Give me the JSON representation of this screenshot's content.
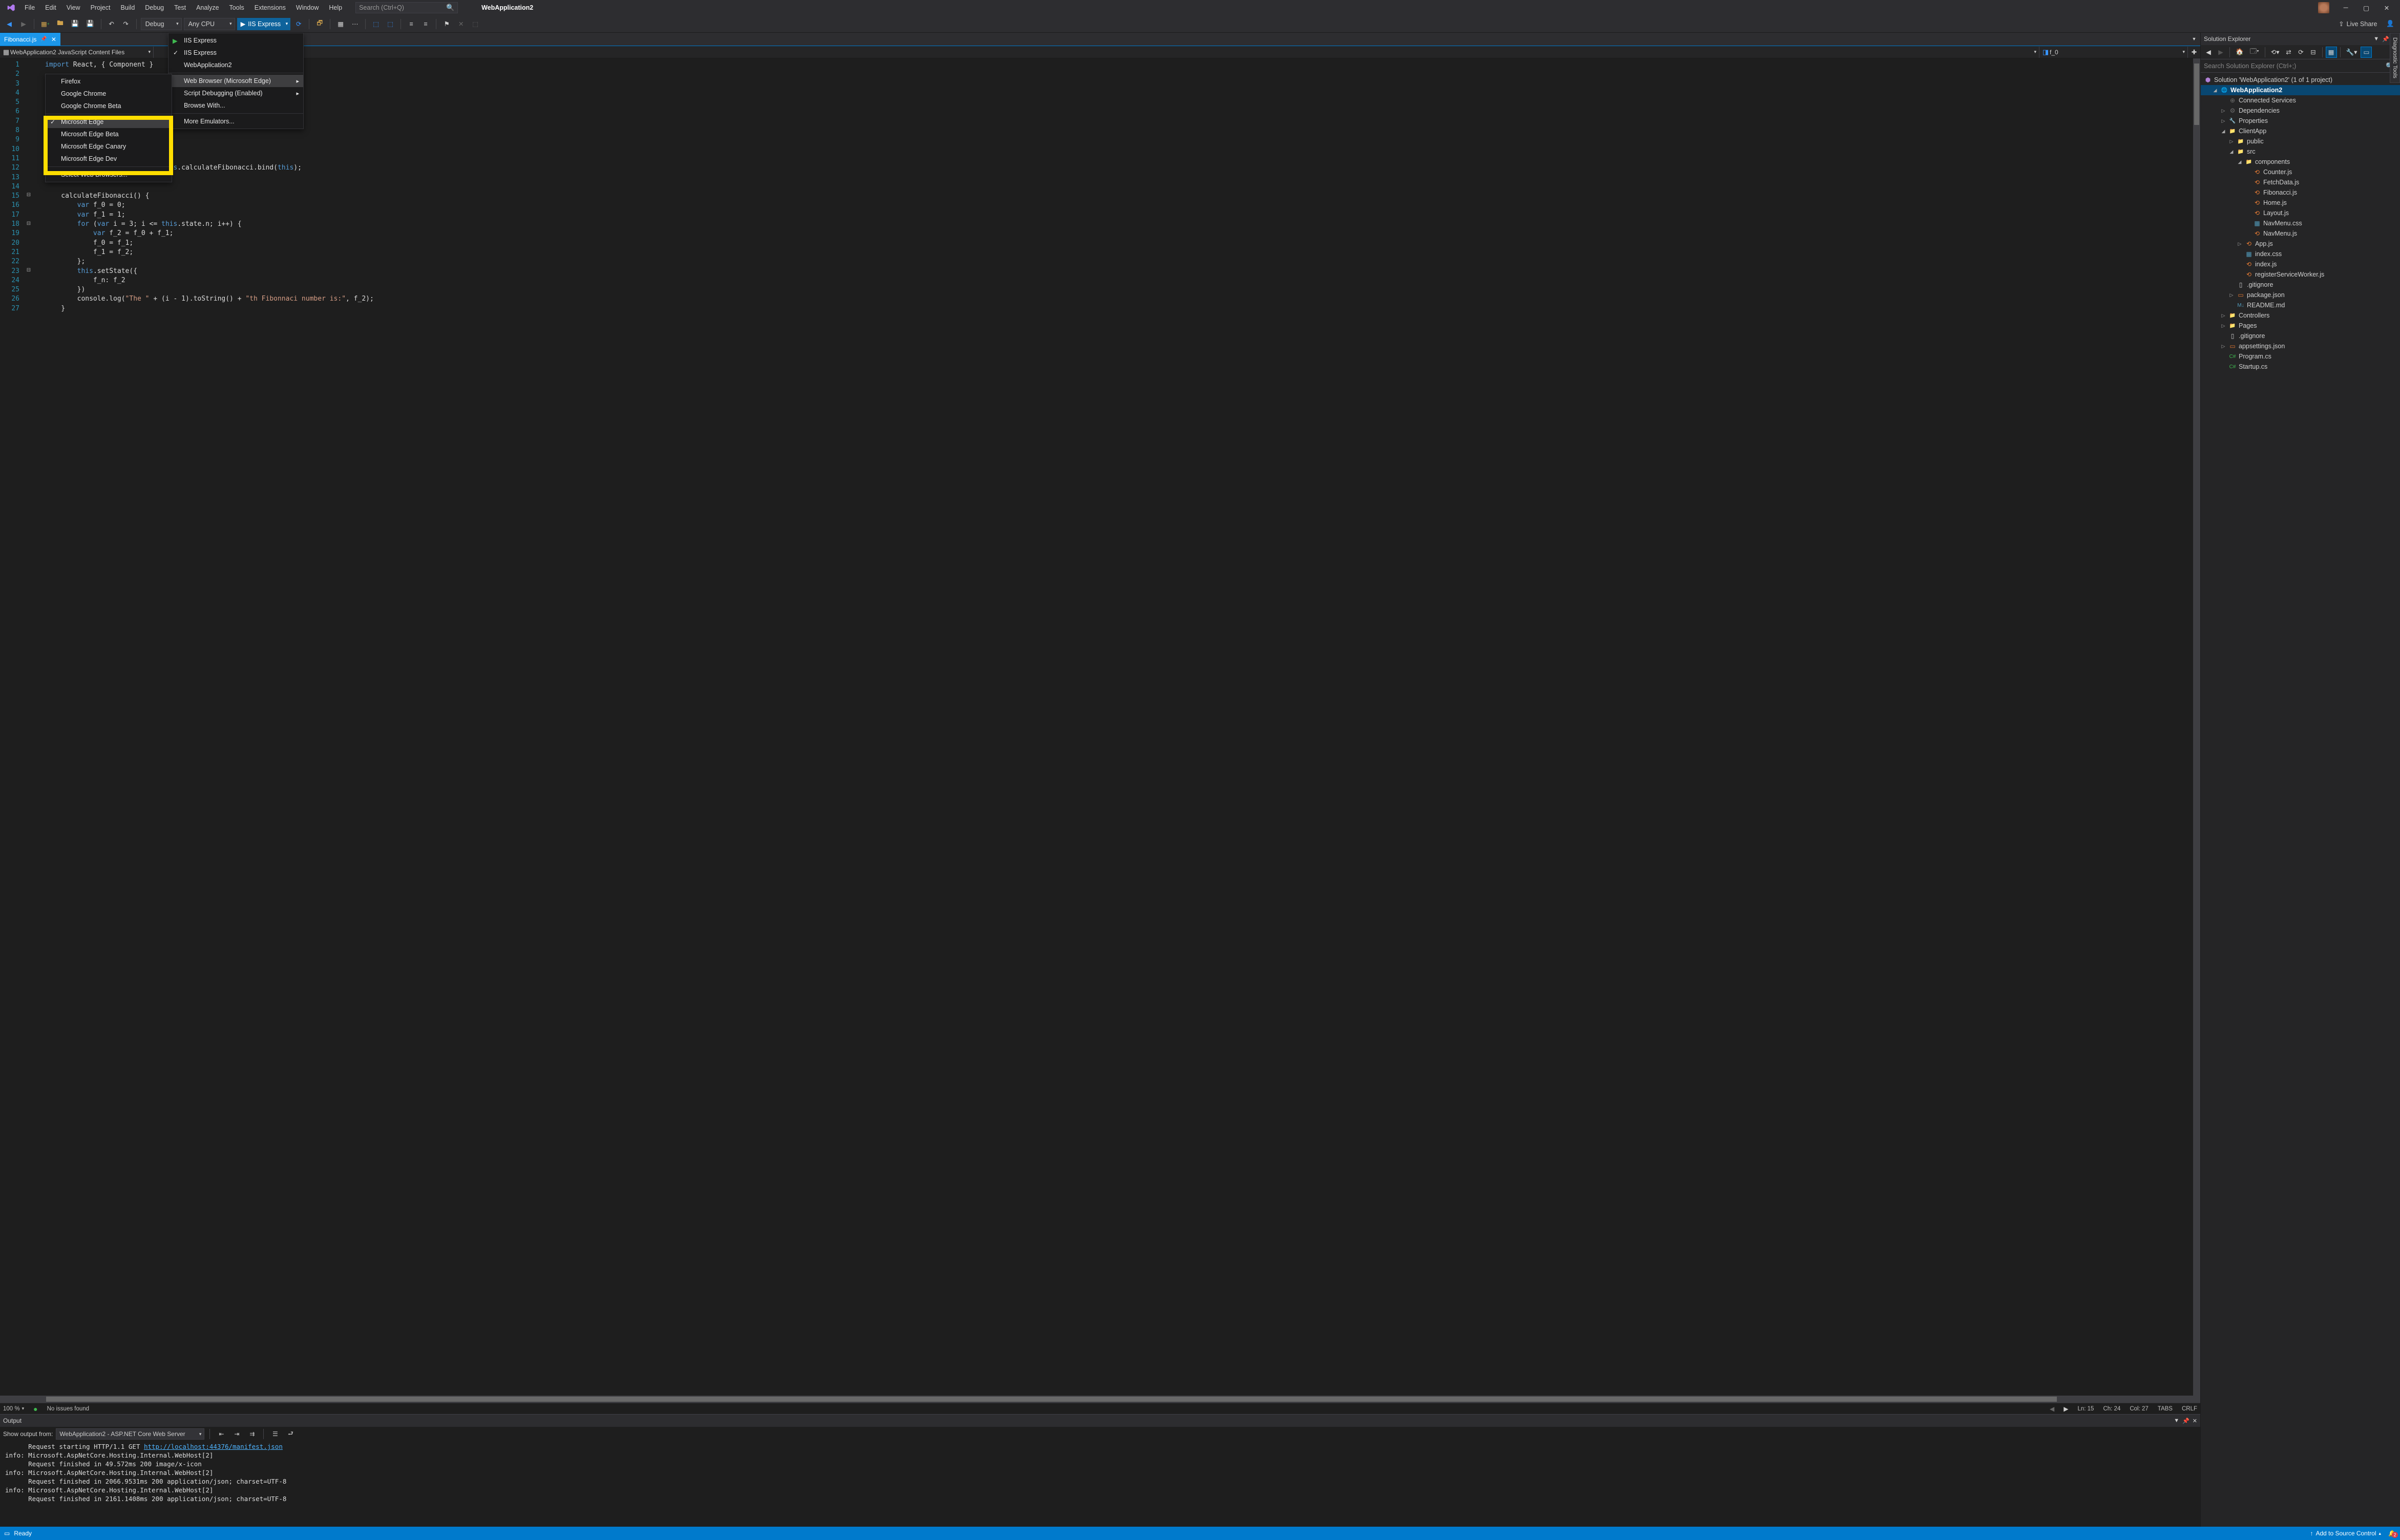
{
  "title_app": "WebApplication2",
  "menu": [
    "File",
    "Edit",
    "View",
    "Project",
    "Build",
    "Debug",
    "Test",
    "Analyze",
    "Tools",
    "Extensions",
    "Window",
    "Help"
  ],
  "search_placeholder": "Search (Ctrl+Q)",
  "toolbar": {
    "config": "Debug",
    "platform": "Any CPU",
    "run": "IIS Express",
    "liveshare": "Live Share"
  },
  "debug_menu": {
    "items": [
      {
        "label": "IIS Express",
        "icon": "play",
        "chk": false
      },
      {
        "label": "IIS Express",
        "chk": true
      },
      {
        "label": "WebApplication2"
      }
    ],
    "sep1": true,
    "items2": [
      {
        "label": "Web Browser (Microsoft Edge)",
        "sub": true,
        "hov": true
      },
      {
        "label": "Script Debugging (Enabled)",
        "sub": true
      },
      {
        "label": "Browse With..."
      }
    ],
    "sep2": true,
    "items3": [
      {
        "label": "More Emulators..."
      }
    ]
  },
  "browser_menu": {
    "top": [
      {
        "label": "Firefox"
      },
      {
        "label": "Google Chrome"
      },
      {
        "label": "Google Chrome Beta"
      }
    ],
    "boxed": [
      {
        "label": "Microsoft Edge",
        "chk": true,
        "hov": true
      },
      {
        "label": "Microsoft Edge Beta"
      },
      {
        "label": "Microsoft Edge Canary"
      },
      {
        "label": "Microsoft Edge Dev"
      }
    ],
    "bottom": [
      {
        "label": "Select Web Browsers..."
      }
    ]
  },
  "editor": {
    "tab": "Fibonacci.js",
    "nav_scope": "WebApplication2 JavaScript Content Files",
    "nav_member": "f_0",
    "no_issues": "No issues found",
    "zoom": "100 %",
    "ln": "Ln: 15",
    "ch": "Ch: 24",
    "col": "Col: 27",
    "tabs": "TABS",
    "crlf": "CRLF"
  },
  "code_lines": [
    {
      "n": 1,
      "html": "<span class='kw'>import</span> React, { Component }"
    },
    {
      "n": 2,
      "html": ""
    },
    {
      "n": 3,
      "html": ""
    },
    {
      "n": 4,
      "html": ""
    },
    {
      "n": 5,
      "html": ""
    },
    {
      "n": 6,
      "html": ""
    },
    {
      "n": 7,
      "html": ""
    },
    {
      "n": 8,
      "html": ""
    },
    {
      "n": 9,
      "html": ""
    },
    {
      "n": 10,
      "html": ""
    },
    {
      "n": 11,
      "html": ""
    },
    {
      "n": 12,
      "html": "                         <span style='color:#dcdcdc'>i</span> = <span class='kw'>this</span>.calculateFibonacci.bind(<span class='kw'>this</span>);"
    },
    {
      "n": 13,
      "html": ""
    },
    {
      "n": 14,
      "html": ""
    },
    {
      "n": 15,
      "html": "    calculateFibonacci() {"
    },
    {
      "n": 16,
      "html": "        <span class='kw'>var</span> f_0 = 0;"
    },
    {
      "n": 17,
      "html": "        <span class='kw'>var</span> f_1 = 1;"
    },
    {
      "n": 18,
      "html": "        <span class='kw'>for</span> (<span class='kw'>var</span> i = 3; i &lt;= <span class='kw'>this</span>.state.n; i++) {"
    },
    {
      "n": 19,
      "html": "            <span class='kw'>var</span> f_2 = f_0 + f_1;"
    },
    {
      "n": 20,
      "html": "            f_0 = f_1;"
    },
    {
      "n": 21,
      "html": "            f_1 = f_2;"
    },
    {
      "n": 22,
      "html": "        };"
    },
    {
      "n": 23,
      "html": "        <span class='kw'>this</span>.setState({"
    },
    {
      "n": 24,
      "html": "            f_n: f_2"
    },
    {
      "n": 25,
      "html": "        })"
    },
    {
      "n": 26,
      "html": "        console.log(<span class='st'>\"The \"</span> + (i - 1).toString() + <span class='st'>\"th Fibonnaci number is:\"</span>, f_2);"
    },
    {
      "n": 27,
      "html": "    }"
    }
  ],
  "output": {
    "title": "Output",
    "from_label": "Show output from:",
    "from_value": "WebApplication2 - ASP.NET Core Web Server",
    "lines": [
      "      Request starting HTTP/1.1 GET <a>http://localhost:44376/manifest.json</a>",
      "info: Microsoft.AspNetCore.Hosting.Internal.WebHost[2]",
      "      Request finished in 49.572ms 200 image/x-icon",
      "info: Microsoft.AspNetCore.Hosting.Internal.WebHost[2]",
      "      Request finished in 2066.9531ms 200 application/json; charset=UTF-8",
      "info: Microsoft.AspNetCore.Hosting.Internal.WebHost[2]",
      "      Request finished in 2161.1408ms 200 application/json; charset=UTF-8"
    ]
  },
  "solution_explorer": {
    "title": "Solution Explorer",
    "search_placeholder": "Search Solution Explorer (Ctrl+;)",
    "sln": "Solution 'WebApplication2' (1 of 1 project)",
    "tree": [
      {
        "d": 1,
        "tw": "◢",
        "ic": "🌐",
        "cls": "",
        "txt": "WebApplication2",
        "sel": true,
        "bold": true
      },
      {
        "d": 2,
        "tw": "",
        "ic": "⊕",
        "cls": "c-conf",
        "txt": "Connected Services"
      },
      {
        "d": 2,
        "tw": "▷",
        "ic": "⚙",
        "cls": "c-conf",
        "txt": "Dependencies"
      },
      {
        "d": 2,
        "tw": "▷",
        "ic": "🔧",
        "cls": "c-conf",
        "txt": "Properties"
      },
      {
        "d": 2,
        "tw": "◢",
        "ic": "📁",
        "cls": "c-fold",
        "txt": "ClientApp"
      },
      {
        "d": 3,
        "tw": "▷",
        "ic": "📁",
        "cls": "c-fold",
        "txt": "public"
      },
      {
        "d": 3,
        "tw": "◢",
        "ic": "📁",
        "cls": "c-fold",
        "txt": "src"
      },
      {
        "d": 4,
        "tw": "◢",
        "ic": "📁",
        "cls": "c-fold",
        "txt": "components"
      },
      {
        "d": 5,
        "tw": "",
        "ic": "⟲",
        "cls": "c-js",
        "txt": "Counter.js"
      },
      {
        "d": 5,
        "tw": "",
        "ic": "⟲",
        "cls": "c-js",
        "txt": "FetchData.js"
      },
      {
        "d": 5,
        "tw": "",
        "ic": "⟲",
        "cls": "c-js",
        "txt": "Fibonacci.js"
      },
      {
        "d": 5,
        "tw": "",
        "ic": "⟲",
        "cls": "c-js",
        "txt": "Home.js"
      },
      {
        "d": 5,
        "tw": "",
        "ic": "⟲",
        "cls": "c-js",
        "txt": "Layout.js"
      },
      {
        "d": 5,
        "tw": "",
        "ic": "▦",
        "cls": "c-css",
        "txt": "NavMenu.css"
      },
      {
        "d": 5,
        "tw": "",
        "ic": "⟲",
        "cls": "c-js",
        "txt": "NavMenu.js"
      },
      {
        "d": 4,
        "tw": "▷",
        "ic": "⟲",
        "cls": "c-js",
        "txt": "App.js"
      },
      {
        "d": 4,
        "tw": "",
        "ic": "▦",
        "cls": "c-css",
        "txt": "index.css"
      },
      {
        "d": 4,
        "tw": "",
        "ic": "⟲",
        "cls": "c-js",
        "txt": "index.js"
      },
      {
        "d": 4,
        "tw": "",
        "ic": "⟲",
        "cls": "c-js",
        "txt": "registerServiceWorker.js"
      },
      {
        "d": 3,
        "tw": "",
        "ic": "▯",
        "cls": "c-txt",
        "txt": ".gitignore"
      },
      {
        "d": 3,
        "tw": "▷",
        "ic": "▭",
        "cls": "c-json",
        "txt": "package.json"
      },
      {
        "d": 3,
        "tw": "",
        "ic": "M↓",
        "cls": "c-md",
        "txt": "README.md"
      },
      {
        "d": 2,
        "tw": "▷",
        "ic": "📁",
        "cls": "c-fold",
        "txt": "Controllers"
      },
      {
        "d": 2,
        "tw": "▷",
        "ic": "📁",
        "cls": "c-fold",
        "txt": "Pages"
      },
      {
        "d": 2,
        "tw": "",
        "ic": "▯",
        "cls": "c-txt",
        "txt": ".gitignore"
      },
      {
        "d": 2,
        "tw": "▷",
        "ic": "▭",
        "cls": "c-json",
        "txt": "appsettings.json"
      },
      {
        "d": 2,
        "tw": "",
        "ic": "C#",
        "cls": "c-cs",
        "txt": "Program.cs"
      },
      {
        "d": 2,
        "tw": "",
        "ic": "C#",
        "cls": "c-cs",
        "txt": "Startup.cs"
      }
    ]
  },
  "status": {
    "ready": "Ready",
    "src_ctrl": "Add to Source Control",
    "notif": "2"
  },
  "side_tab": "Diagnostic Tools"
}
